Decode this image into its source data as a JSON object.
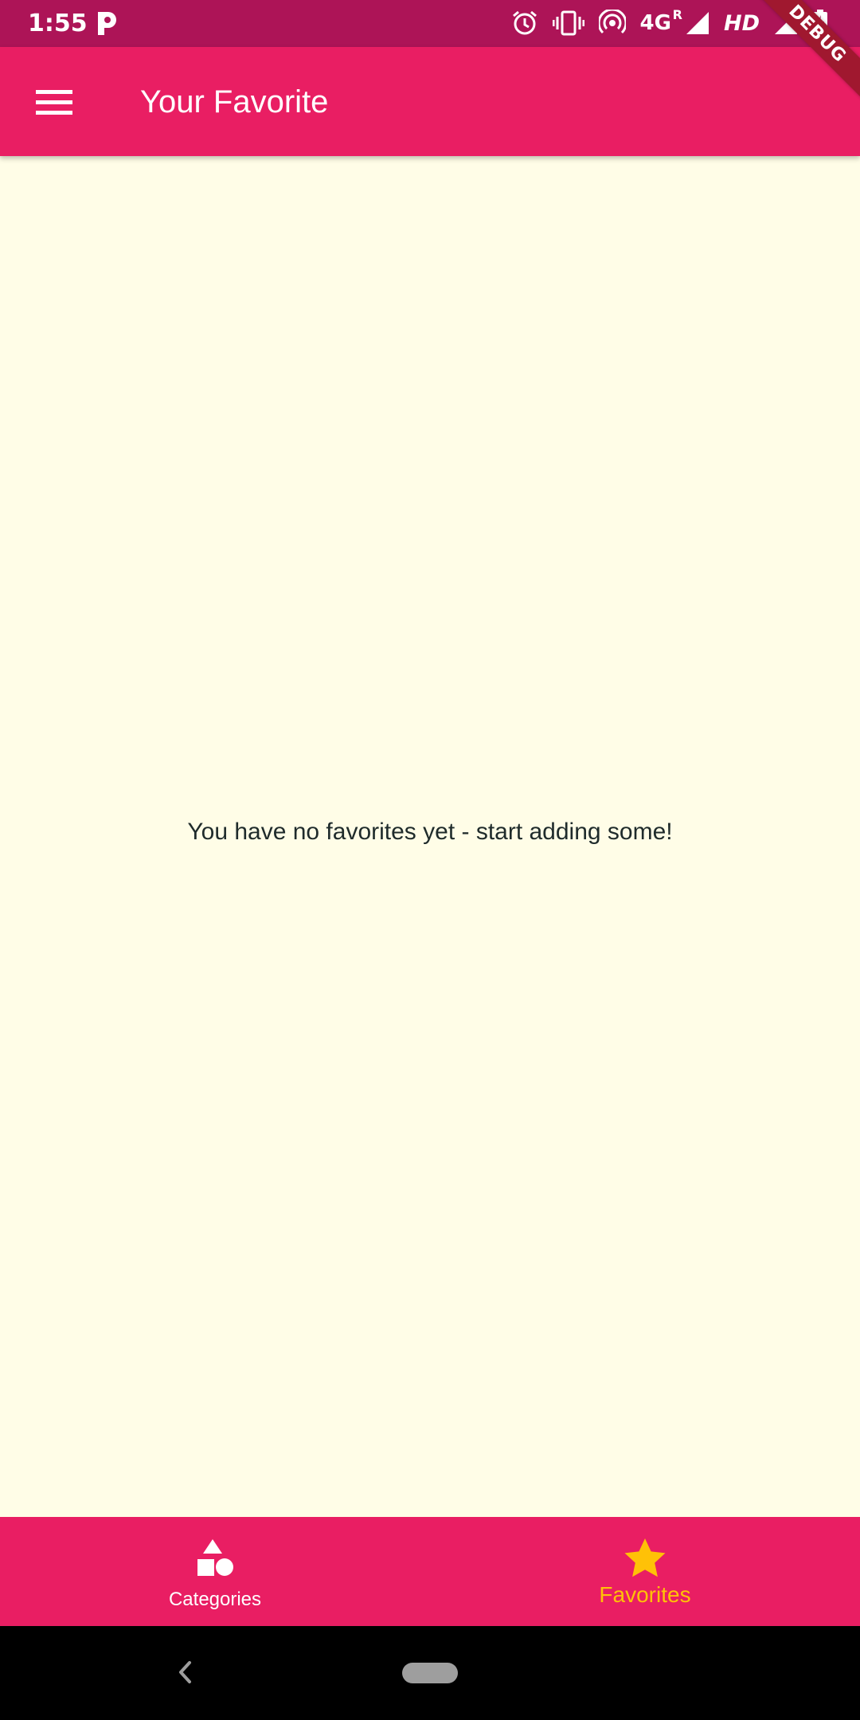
{
  "status_bar": {
    "time": "1:55",
    "network": "4G",
    "roaming": "R",
    "hd": "HD",
    "icons": [
      "p-app-icon",
      "alarm-icon",
      "vibrate-icon",
      "hotspot-icon",
      "signal-icon",
      "hd-signal-icon",
      "battery-charging-icon"
    ]
  },
  "debug_banner": "DEBUG",
  "app_bar": {
    "title": "Your Favorite",
    "menu_icon": "hamburger-menu-icon"
  },
  "body": {
    "empty_message": "You have no favorites yet - start adding some!"
  },
  "bottom_nav": {
    "items": [
      {
        "label": "Categories",
        "icon": "category-shapes-icon",
        "active": false
      },
      {
        "label": "Favorites",
        "icon": "star-icon",
        "active": true
      }
    ]
  },
  "colors": {
    "status_bar": "#AD1457",
    "primary": "#E91E63",
    "accent": "#FFC107",
    "background": "#FFFDE7"
  }
}
